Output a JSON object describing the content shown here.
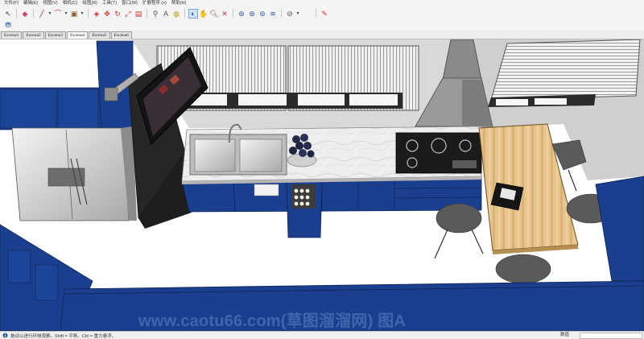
{
  "menu": {
    "items": [
      "文件(F)",
      "编辑(E)",
      "视图(V)",
      "相机(C)",
      "绘图(R)",
      "工具(T)",
      "窗口(W)",
      "扩展程序 (x)",
      "帮助(H)"
    ]
  },
  "toolbar": {
    "icons": [
      "select-icon",
      "eraser-icon",
      "line-icon",
      "arc-icon",
      "shape-icon",
      "push-pull-icon",
      "move-icon",
      "rotate-icon",
      "scale-icon",
      "offset-icon",
      "tape-measure-icon",
      "text-icon",
      "paint-bucket-icon",
      "orbit-icon",
      "pan-icon",
      "zoom-icon",
      "zoom-extents-icon",
      "previous-view-icon",
      "next-view-icon",
      "camera-icon",
      "walk-icon",
      "section-icon",
      "edit-icon"
    ],
    "active_tool": "orbit"
  },
  "scene_tabs": [
    "Escena1",
    "Escena2",
    "Escena3",
    "Escena4",
    "Escena5",
    "Escena6"
  ],
  "active_scene": "Escena4",
  "watermark": "www.caotu66.com(草图溜溜网) 图A",
  "status": {
    "hint": "拖动以进行环绕观察。Shift = 平移。Ctrl = 重力悬浮。",
    "measure_label": "数值",
    "measure_value": ""
  },
  "colors": {
    "cabinet_blue": "#1b3f8f",
    "active_tool_bg": "#cfe3f7",
    "watermark": "#3e66aa"
  }
}
